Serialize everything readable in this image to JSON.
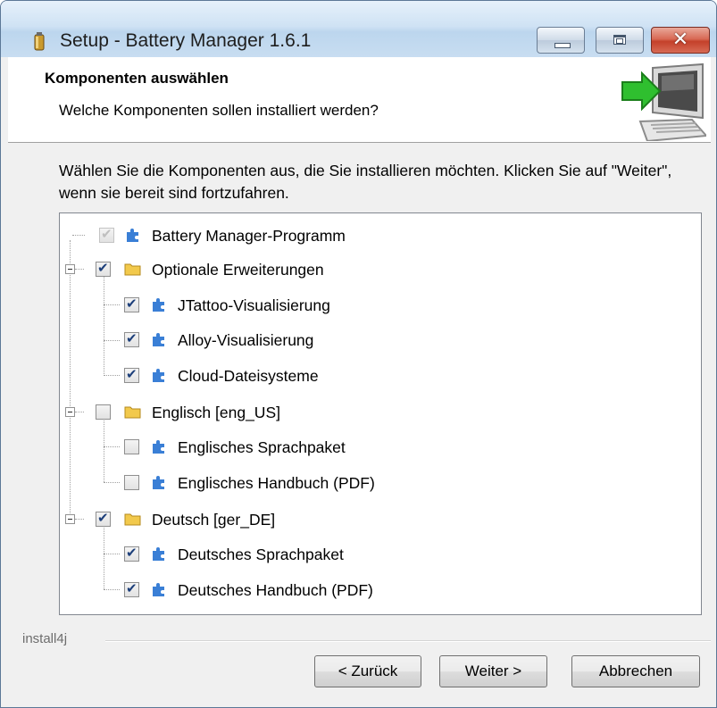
{
  "window": {
    "title": "Setup - Battery Manager 1.6.1",
    "controls": [
      "minimize-icon",
      "maximize-icon",
      "close-icon"
    ]
  },
  "header": {
    "title": "Komponenten auswählen",
    "subtitle": "Welche Komponenten sollen installiert werden?",
    "graphic": "computer-install-arrow-icon"
  },
  "description": "Wählen Sie die Komponenten aus, die Sie installieren möchten. Klicken Sie auf \"Weiter\", wenn sie bereit sind fortzufahren.",
  "tree": {
    "items": [
      {
        "label": "Battery Manager-Programm",
        "checked": true,
        "disabled": true,
        "icon": "puzzle-icon"
      },
      {
        "label": "Optionale Erweiterungen",
        "checked": true,
        "icon": "folder-icon",
        "expanded": true
      },
      {
        "label": "JTattoo-Visualisierung",
        "checked": true,
        "icon": "puzzle-icon"
      },
      {
        "label": "Alloy-Visualisierung",
        "checked": true,
        "icon": "puzzle-icon"
      },
      {
        "label": "Cloud-Dateisysteme",
        "checked": true,
        "icon": "puzzle-icon"
      },
      {
        "label": "Englisch [eng_US]",
        "checked": false,
        "icon": "folder-icon",
        "expanded": true
      },
      {
        "label": "Englisches Sprachpaket",
        "checked": false,
        "icon": "puzzle-icon"
      },
      {
        "label": "Englisches Handbuch (PDF)",
        "checked": false,
        "icon": "puzzle-icon"
      },
      {
        "label": "Deutsch [ger_DE]",
        "checked": true,
        "icon": "folder-icon",
        "expanded": true
      },
      {
        "label": "Deutsches Sprachpaket",
        "checked": true,
        "icon": "puzzle-icon"
      },
      {
        "label": "Deutsches Handbuch (PDF)",
        "checked": true,
        "icon": "puzzle-icon"
      }
    ]
  },
  "footer": {
    "brand": "install4j",
    "back_label": "< Zurück",
    "next_label": "Weiter >",
    "cancel_label": "Abbrechen"
  },
  "colors": {
    "puzzle": "#3a7fd6",
    "folder": "#f2c94c",
    "check": "#1d3f7a"
  }
}
